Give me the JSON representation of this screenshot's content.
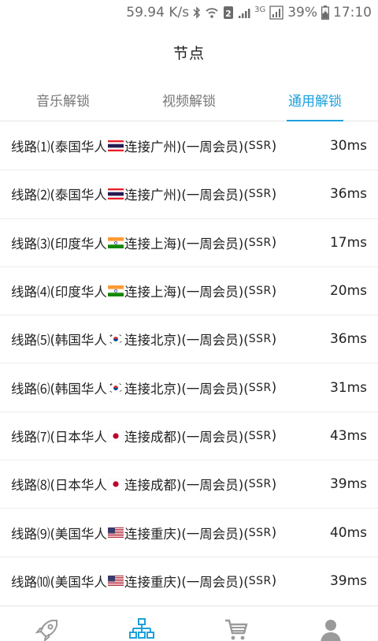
{
  "status_bar": {
    "net_speed": "59.94 K/s",
    "network_type": "3G",
    "battery": "39%",
    "time": "17:10"
  },
  "header": {
    "title": "节点"
  },
  "tabs": [
    {
      "label": "音乐解锁",
      "active": false
    },
    {
      "label": "视频解锁",
      "active": false
    },
    {
      "label": "通用解锁",
      "active": true
    }
  ],
  "nodes": [
    {
      "prefix": "线路⑴(泰国华人",
      "flag": "thailand-flag-icon",
      "suffix": "连接广州)(一周会员)(",
      "proto": "SSR",
      "end": ")",
      "ping": "30ms"
    },
    {
      "prefix": "线路⑵(泰国华人",
      "flag": "thailand-flag-icon",
      "suffix": "连接广州)(一周会员)(",
      "proto": "SSR",
      "end": ")",
      "ping": "36ms"
    },
    {
      "prefix": "线路⑶(印度华人",
      "flag": "india-flag-icon",
      "suffix": "连接上海)(一周会员)(",
      "proto": "SSR",
      "end": ")",
      "ping": "17ms"
    },
    {
      "prefix": "线路⑷(印度华人",
      "flag": "india-flag-icon",
      "suffix": "连接上海)(一周会员)(",
      "proto": "SSR",
      "end": ")",
      "ping": "20ms"
    },
    {
      "prefix": "线路⑸(韩国华人",
      "flag": "korea-flag-icon",
      "suffix": "连接北京)(一周会员)(",
      "proto": "SSR",
      "end": ")",
      "ping": "36ms"
    },
    {
      "prefix": "线路⑹(韩国华人",
      "flag": "korea-flag-icon",
      "suffix": "连接北京)(一周会员)(",
      "proto": "SSR",
      "end": ")",
      "ping": "31ms"
    },
    {
      "prefix": "线路⑺(日本华人",
      "flag": "japan-flag-icon",
      "suffix": "连接成都)(一周会员)(",
      "proto": "SSR",
      "end": ")",
      "ping": "43ms"
    },
    {
      "prefix": "线路⑻(日本华人",
      "flag": "japan-flag-icon",
      "suffix": "连接成都)(一周会员)(",
      "proto": "SSR",
      "end": ")",
      "ping": "39ms"
    },
    {
      "prefix": "线路⑼(美国华人",
      "flag": "usa-flag-icon",
      "suffix": "连接重庆)(一周会员)(",
      "proto": "SSR",
      "end": ")",
      "ping": "40ms"
    },
    {
      "prefix": "线路⑽(美国华人",
      "flag": "usa-flag-icon",
      "suffix": "连接重庆)(一周会员)(",
      "proto": "SSR",
      "end": ")",
      "ping": "39ms"
    }
  ],
  "bottom_nav": [
    {
      "icon": "rocket-icon",
      "active": false
    },
    {
      "icon": "network-tree-icon",
      "active": true
    },
    {
      "icon": "cart-icon",
      "active": false
    },
    {
      "icon": "user-icon",
      "active": false
    }
  ],
  "colors": {
    "accent": "#1ea0dc",
    "inactive_icon": "#9a9a9a",
    "text": "#222222"
  }
}
